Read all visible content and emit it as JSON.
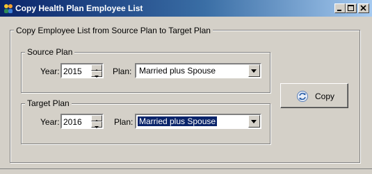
{
  "window": {
    "title": "Copy Health Plan Employee List",
    "icon": "people-icon",
    "controls": [
      "minimize-icon",
      "maximize-icon",
      "close-icon"
    ],
    "titlebar_color": "#0a246a"
  },
  "main_group": {
    "legend": "Copy Employee List from Source Plan to Target Plan"
  },
  "source": {
    "legend": "Source Plan",
    "year_label": "Year:",
    "year_value": "2015",
    "plan_label": "Plan:",
    "plan_value": "Married plus Spouse"
  },
  "target": {
    "legend": "Target Plan",
    "year_label": "Year:",
    "year_value": "2016",
    "plan_label": "Plan:",
    "plan_value": "Married plus Spouse",
    "plan_selected": true
  },
  "copy_button": {
    "label": "Copy",
    "icon": "refresh-copy-icon"
  }
}
